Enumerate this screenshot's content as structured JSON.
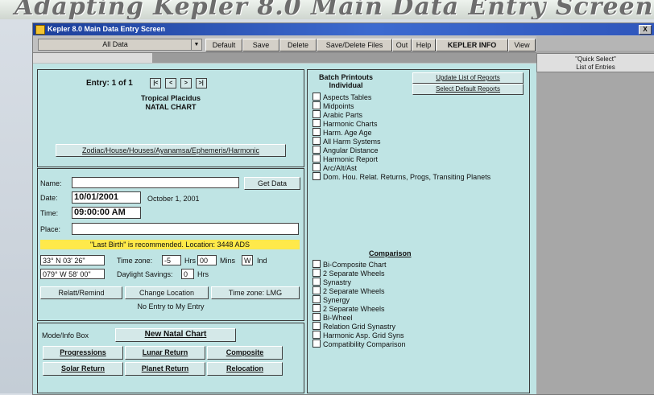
{
  "banner": {
    "text": "Adapting Kepler 8.0 Main Data Entry Screen"
  },
  "window": {
    "title": "Kepler 8.0 Main Data Entry Screen",
    "close_label": "X"
  },
  "toolbar": {
    "dropdown_value": "All Data",
    "dropdown_arrow": "▼",
    "buttons": [
      "Default",
      "Save",
      "Delete",
      "Save/Delete Files",
      "Out",
      "Help",
      "KEPLER INFO",
      "View"
    ]
  },
  "entry": {
    "nav_text": "Entry: 1 of 1",
    "nav_buttons": [
      "|<",
      "<",
      ">",
      ">|"
    ],
    "chart_type_line1": "Tropical Placidus",
    "chart_type_line2": "NATAL CHART",
    "zodiac_button": "Zodiac/House/Houses/Ayanamsa/Ephemeris/Harmonic"
  },
  "form": {
    "name_label": "Name:",
    "name_value": "",
    "get_data_button": "Get Data",
    "date_label": "Date:",
    "date_value": "10/01/2001",
    "date_text": "October 1, 2001",
    "time_label": "Time:",
    "time_value": "09:00:00 AM",
    "place_label": "Place:",
    "place_value": "",
    "status_text": "\"Last Birth\" is recommended. Location: 3448 ADS",
    "lat_value": "33° N 03' 26\"",
    "long_value": "079° W 58' 00\"",
    "tz_label": "Time zone:",
    "tz_hours": "-5",
    "tz_hrs_label": "Hrs",
    "tz_mins": "00",
    "tz_mins_label": "Mins",
    "tz_dir": "W",
    "tz_ind": "Ind",
    "dst_label": "Daylight Savings:",
    "dst_value": "0",
    "dst_unit": "Hrs",
    "buttons": [
      "Relatt/Remind",
      "Change Location",
      "Time zone: LMG"
    ],
    "note": "No Entry to My Entry"
  },
  "tz_panel": {
    "label": "Mode/Info Box",
    "new_chart_button": "New Natal Chart",
    "buttons": [
      "Progressions",
      "Lunar Return",
      "Composite",
      "Solar Return",
      "Planet Return",
      "Relocation"
    ]
  },
  "list_panel": {
    "individual_header": "Batch Printouts\nIndividual",
    "individual_items": [
      "Aspects Tables",
      "Midpoints",
      "Arabic Parts",
      "Harmonic Charts",
      "Harm. Age Age",
      "All Harm Systems",
      "Angular Distance",
      "Harmonic Report",
      "Arc/Alt/Ast",
      "Dom. Hou. Relat. Returns, Progs, Transiting Planets"
    ],
    "update_button": "Update List of Reports",
    "select_button": "Select Default Reports",
    "comparison_header": "Comparison",
    "comparison_items": [
      "Bi-Composite Chart",
      "2 Separate Wheels",
      "Synastry",
      "2 Separate Wheels",
      "Synergy",
      "2 Separate Wheels",
      "Bi-Wheel",
      "Relation Grid Synastry",
      "Harmonic Asp. Grid Syns",
      "Compatibility Comparison"
    ]
  },
  "side_panel": {
    "title_line1": "\"Quick Select\"",
    "title_line2": "List of Entries"
  }
}
